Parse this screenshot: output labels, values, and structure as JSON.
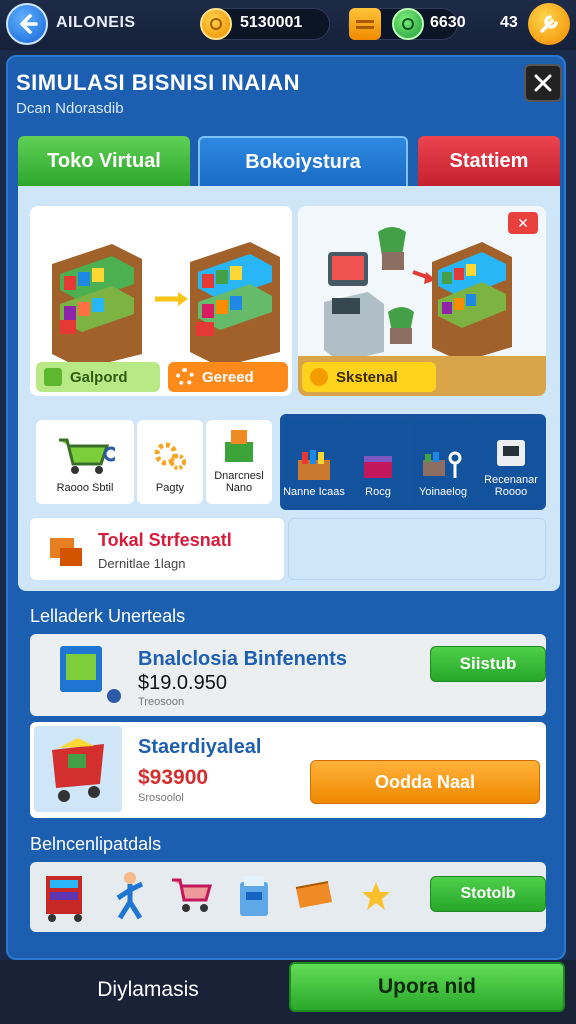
{
  "topbar": {
    "app_name": "AILONEIS",
    "coins": "5130001",
    "tickets": "6630",
    "level": "43"
  },
  "header": {
    "title": "SIMULASI BISNISI INAIAN",
    "subtitle": "Dcan Ndorasdib"
  },
  "tabs": [
    {
      "label": "Toko Virtual",
      "color": "#3db33a"
    },
    {
      "label": "Bokoiystura",
      "color": "#1f76d2"
    },
    {
      "label": "Stattiem",
      "color": "#d8293a"
    }
  ],
  "store_cards": {
    "left_btn1": "Galpord",
    "left_btn2": "Gereed",
    "right_btn": "Skstenal"
  },
  "items_white": [
    {
      "label": "Raooo Sbtil"
    },
    {
      "label": "Pagty"
    },
    {
      "label": "Dnarcnesl Nano"
    }
  ],
  "items_dark": [
    {
      "label": "Nanne Icaas"
    },
    {
      "label": "Rocg"
    },
    {
      "label": "Yoinaelog"
    },
    {
      "label": "Recenanar Roooo"
    }
  ],
  "total_card": {
    "title": "Tokal Strfesnatl",
    "subtitle": "Dernitlae 1lagn"
  },
  "leaderboard": {
    "heading": "Lelladerk Unerteals",
    "rows": [
      {
        "title": "Bnalclosia Binfenents",
        "price": "$19.0.950",
        "note": "Treosoon",
        "button": "Siistub"
      },
      {
        "title": "Staerdiyaleal",
        "price": "$93900",
        "note": "Srosoolol",
        "button": "Oodda Naal"
      }
    ]
  },
  "belnscen": {
    "heading": "Belncenlipatdals",
    "button": "Stotolb"
  },
  "bottom": {
    "left_label": "Diylamasis",
    "right_label": "Upora nid"
  }
}
